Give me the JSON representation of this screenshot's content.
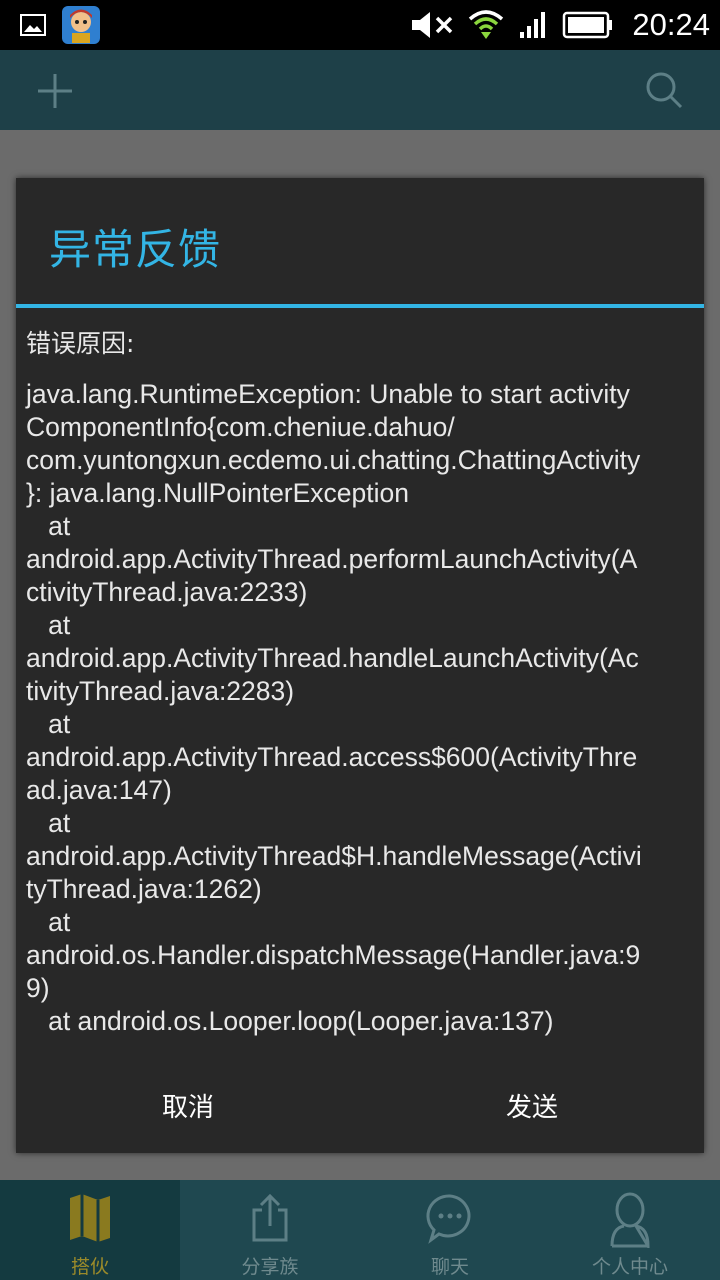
{
  "status_bar": {
    "time": "20:24",
    "icons": [
      "gallery-icon",
      "app-avatar-icon",
      "mute-icon",
      "wifi-icon",
      "signal-icon",
      "battery-icon"
    ]
  },
  "action_bar": {
    "icons": [
      "add-icon",
      "search-icon"
    ]
  },
  "dialog": {
    "title": "异常反馈",
    "error_label": "错误原因:",
    "error_lines": [
      "java.lang.RuntimeException: Unable to start activity",
      "ComponentInfo{com.cheniue.dahuo/",
      "com.yuntongxun.ecdemo.ui.chatting.ChattingActivity",
      "}: java.lang.NullPointerException",
      "   at",
      "android.app.ActivityThread.performLaunchActivity(A",
      "ctivityThread.java:2233)",
      "   at",
      "android.app.ActivityThread.handleLaunchActivity(Ac",
      "tivityThread.java:2283)",
      "   at",
      "android.app.ActivityThread.access$600(ActivityThre",
      "ad.java:147)",
      "   at",
      "android.app.ActivityThread$H.handleMessage(Activi",
      "tyThread.java:1262)",
      "   at",
      "android.os.Handler.dispatchMessage(Handler.java:9",
      "9)",
      "   at android.os.Looper.loop(Looper.java:137)"
    ],
    "cancel_label": "取消",
    "send_label": "发送"
  },
  "bottom_nav": {
    "items": [
      {
        "label": "搭伙",
        "icon": "map-icon",
        "active": true
      },
      {
        "label": "分享族",
        "icon": "share-icon",
        "active": false
      },
      {
        "label": "聊天",
        "icon": "chat-icon",
        "active": false
      },
      {
        "label": "个人中心",
        "icon": "person-icon",
        "active": false
      }
    ]
  },
  "colors": {
    "accent": "#33b5e5",
    "dialog_bg": "#282828",
    "active_nav": "#9a8a2a"
  }
}
